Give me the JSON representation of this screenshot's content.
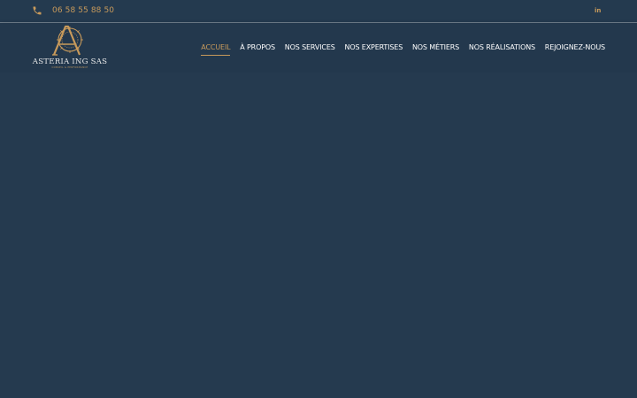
{
  "topbar": {
    "phone": "06 58 55 88 50",
    "linkedin_label": "in"
  },
  "logo": {
    "name": "ASTERIA ING SAS",
    "tagline": "CONSEIL & PERFORMANCE"
  },
  "nav": {
    "items": [
      {
        "label": "ACCUEIL",
        "active": true
      },
      {
        "label": "À PROPOS"
      },
      {
        "label": "NOS SERVICES"
      },
      {
        "label": "NOS EXPERTISES"
      },
      {
        "label": "NOS MÉTIERS"
      },
      {
        "label": "NOS RÉALISATIONS"
      },
      {
        "label": "REJOIGNEZ-NOUS"
      }
    ]
  },
  "colors": {
    "background": "#253a4f",
    "accent": "#c89a5b",
    "text": "#ffffff"
  },
  "icons": {
    "phone": "phone-icon",
    "linkedin": "linkedin-icon"
  }
}
